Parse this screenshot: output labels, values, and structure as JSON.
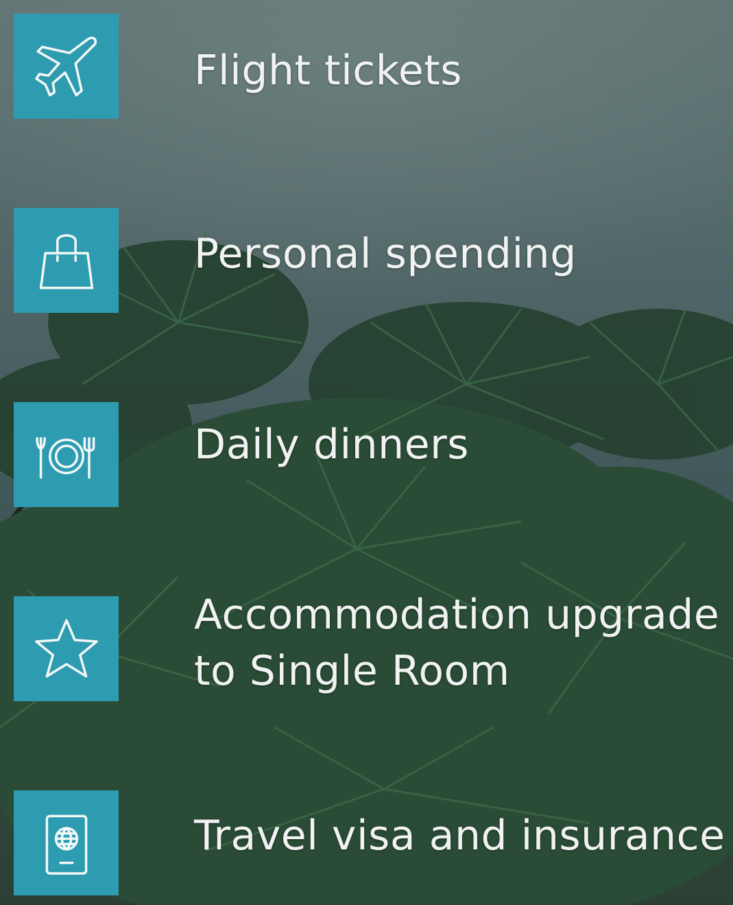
{
  "items": [
    {
      "label": "Flight tickets",
      "icon": "airplane-icon"
    },
    {
      "label": "Personal spending",
      "icon": "shopping-bag-icon"
    },
    {
      "label": "Daily dinners",
      "icon": "plate-cutlery-icon"
    },
    {
      "label": "Accommodation upgrade to Single Room",
      "line1": "Accommodation upgrade",
      "line2": "to Single Room",
      "icon": "star-icon"
    },
    {
      "label": "Travel visa and insurance",
      "icon": "passport-icon"
    }
  ],
  "colors": {
    "icon_background": "#2e9cb0",
    "text": "#f1f3f2",
    "sky": "#5f7473",
    "foliage": "#2c3f35"
  }
}
